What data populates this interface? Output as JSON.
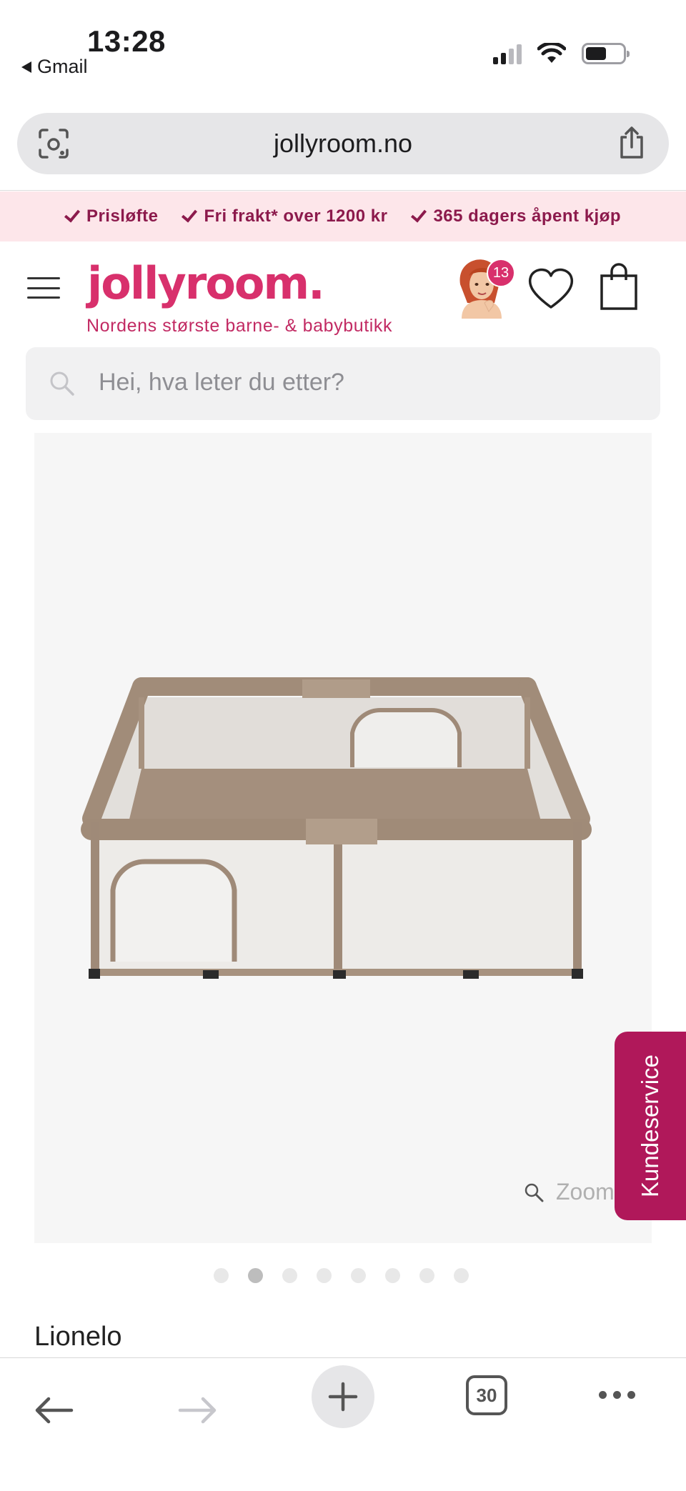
{
  "status_bar": {
    "time": "13:28",
    "back_app": "Gmail"
  },
  "browser": {
    "url": "jollyroom.no",
    "tab_count": "30"
  },
  "usp_strip": {
    "items": [
      "Prisløfte",
      "Fri frakt* over 1200 kr",
      "365 dagers åpent kjøp"
    ]
  },
  "header": {
    "logo": "jollyroom.",
    "tagline": "Nordens største barne- & babybutikk",
    "avatar_badge": "13"
  },
  "search": {
    "placeholder": "Hei, hva leter du etter?"
  },
  "product": {
    "zoom_label": "Zoom",
    "image_count": 8,
    "active_image_index": 1,
    "brand": "Lionelo"
  },
  "customer_service": {
    "label": "Kundeservice"
  },
  "colors": {
    "brand_pink": "#d8306c",
    "usp_bg": "#fde6ea",
    "usp_text": "#8c1a4c",
    "kundeservice_bg": "#b0185a"
  },
  "icons": {
    "url_left": "visual-lookup-icon",
    "url_right": "share-icon",
    "wishlist": "heart-icon",
    "cart": "shopping-bag-icon",
    "search": "search-icon",
    "zoom": "magnifier-icon",
    "toolbar": [
      "back-arrow-icon",
      "forward-arrow-icon",
      "plus-icon",
      "tabs-icon",
      "more-icon"
    ]
  }
}
